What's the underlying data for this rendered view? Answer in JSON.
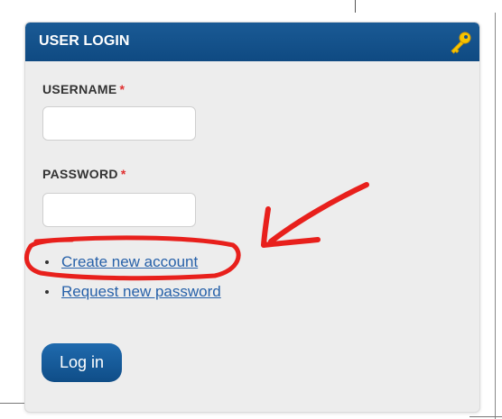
{
  "login_block": {
    "title": "USER LOGIN",
    "icon": "key-icon",
    "username_label": "USERNAME",
    "password_label": "PASSWORD",
    "required_marker": "*",
    "username_value": "",
    "password_value": "",
    "links": [
      {
        "label": "Create new account"
      },
      {
        "label": "Request new password"
      }
    ],
    "submit_label": "Log in"
  },
  "colors": {
    "header": "#0f4a82",
    "link": "#2761a9",
    "required": "#e03030",
    "annotation": "#e8201c",
    "panel_bg": "#ededed"
  }
}
